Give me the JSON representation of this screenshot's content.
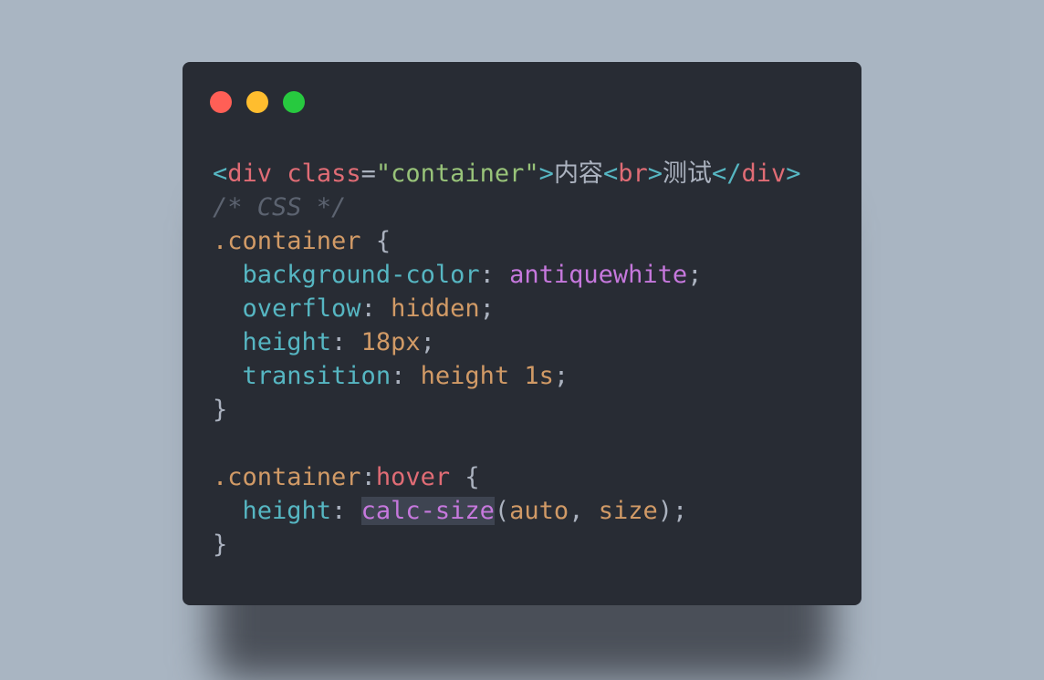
{
  "window": {
    "controls": [
      "close",
      "minimize",
      "maximize"
    ],
    "colors": {
      "background": "#282c34",
      "page": "#a9b5c2",
      "close": "#ff5f56",
      "minimize": "#ffbd2e",
      "maximize": "#27c93f"
    }
  },
  "code": {
    "l1": {
      "open_lt": "<",
      "tag": "div",
      "space": " ",
      "attr": "class",
      "eq": "=",
      "value": "\"container\"",
      "gt": ">",
      "text1": "内容",
      "br_lt": "<",
      "br": "br",
      "br_gt": ">",
      "text2": "测试",
      "close_lt": "</",
      "close_tag": "div",
      "close_gt": ">"
    },
    "l2": {
      "comment": "/* CSS */"
    },
    "l3": {
      "selector": ".container",
      "brace": " {"
    },
    "l4": {
      "indent": "  ",
      "prop": "background-color",
      "colon": ": ",
      "value": "antiquewhite",
      "semi": ";"
    },
    "l5": {
      "indent": "  ",
      "prop": "overflow",
      "colon": ": ",
      "value": "hidden",
      "semi": ";"
    },
    "l6": {
      "indent": "  ",
      "prop": "height",
      "colon": ": ",
      "value": "18px",
      "semi": ";"
    },
    "l7": {
      "indent": "  ",
      "prop": "transition",
      "colon": ": ",
      "value": "height 1s",
      "semi": ";"
    },
    "l8": {
      "brace": "}"
    },
    "l10": {
      "selector": ".container",
      "colon": ":",
      "pseudo": "hover",
      "brace": " {"
    },
    "l11": {
      "indent": "  ",
      "prop": "height",
      "colon": ": ",
      "func": "calc-size",
      "paren_open": "(",
      "arg1": "auto",
      "comma": ", ",
      "arg2": "size",
      "paren_close": ")",
      "semi": ";"
    },
    "l12": {
      "brace": "}"
    }
  }
}
